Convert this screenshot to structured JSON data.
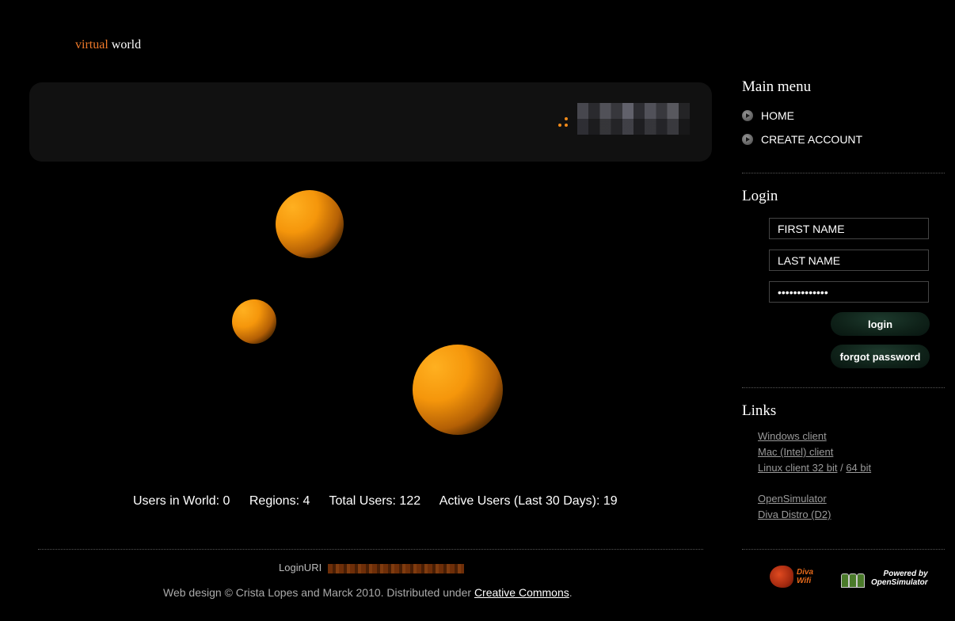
{
  "logo": {
    "accent_text": "virtual",
    "main_text": "world"
  },
  "header": {
    "title_redacted": true
  },
  "stats": {
    "users_in_world": "Users in World: 0",
    "regions": "Regions: 4",
    "total_users": "Total Users: 122",
    "active_users": "Active Users (Last 30 Days): 19"
  },
  "footer": {
    "login_uri_label": "LoginURI",
    "credits_prefix": "Web design © Crista Lopes and Marck 2010. Distributed under ",
    "credits_link": "Creative Commons",
    "credits_suffix": "."
  },
  "sidebar": {
    "main_menu": {
      "heading": "Main menu",
      "items": [
        {
          "label": "HOME"
        },
        {
          "label": "CREATE ACCOUNT"
        }
      ]
    },
    "login": {
      "heading": "Login",
      "first_name_value": "FIRST NAME",
      "last_name_value": "LAST NAME",
      "password_value": "•••••••••••••",
      "login_button": "login",
      "forgot_button": "forgot password"
    },
    "links": {
      "heading": "Links",
      "windows_client": "Windows client",
      "mac_client": "Mac (Intel) client",
      "linux_client": "Linux client 32 bit",
      "linux_sep": "/",
      "linux_64": "64 bit",
      "opensimulator": "OpenSimulator",
      "diva_distro": "Diva Distro (D2)"
    },
    "badges": {
      "diva_line1": "Diva",
      "diva_line2": "Wifi",
      "os_line1": "Powered by",
      "os_line2": "OpenSimulator"
    }
  },
  "colors": {
    "accent": "#f07a2a",
    "sphere": "#f5960b",
    "background": "#000000",
    "panel": "#111111"
  }
}
